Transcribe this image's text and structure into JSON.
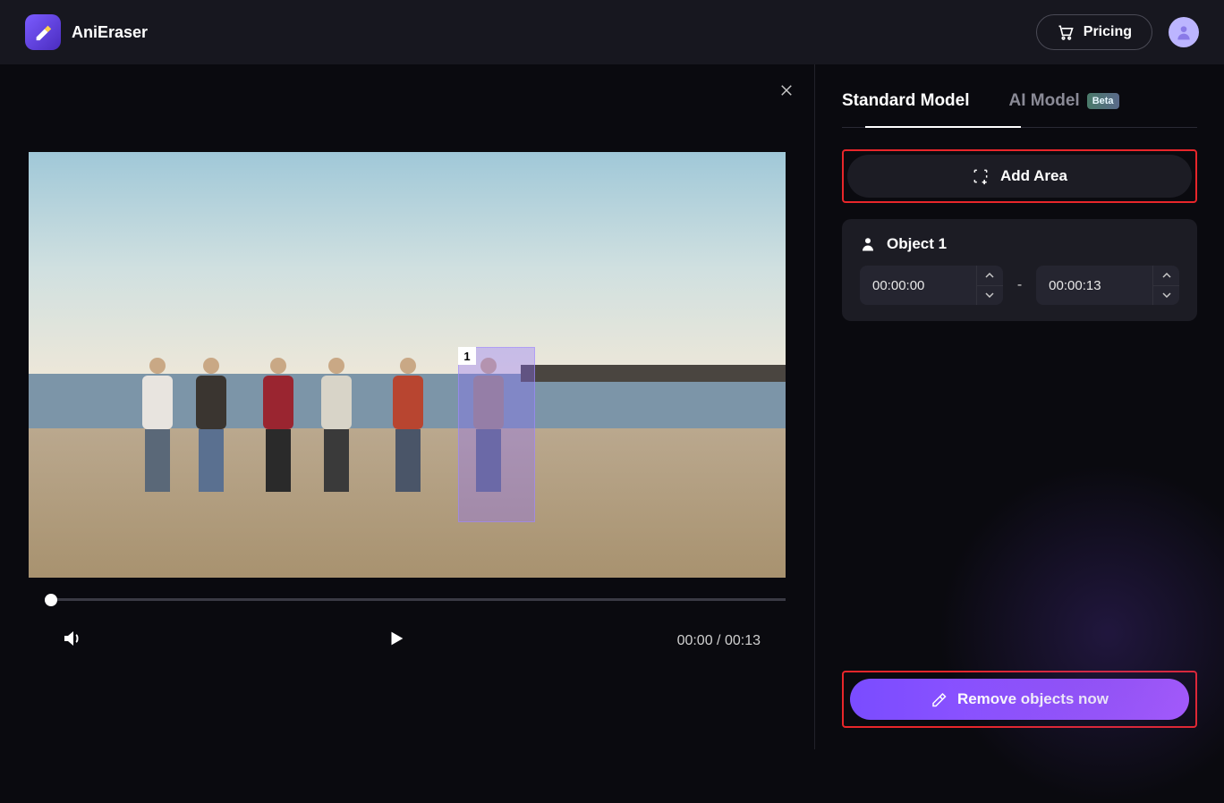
{
  "header": {
    "app_name": "AniEraser",
    "pricing_label": "Pricing"
  },
  "video": {
    "selection_label": "1",
    "current_time": "00:00",
    "duration": "00:13"
  },
  "side": {
    "tabs": {
      "standard": "Standard Model",
      "ai": "AI Model",
      "beta": "Beta"
    },
    "add_area_label": "Add Area",
    "object": {
      "title": "Object 1",
      "start": "00:00:00",
      "end": "00:00:13"
    },
    "remove_label": "Remove objects now"
  }
}
